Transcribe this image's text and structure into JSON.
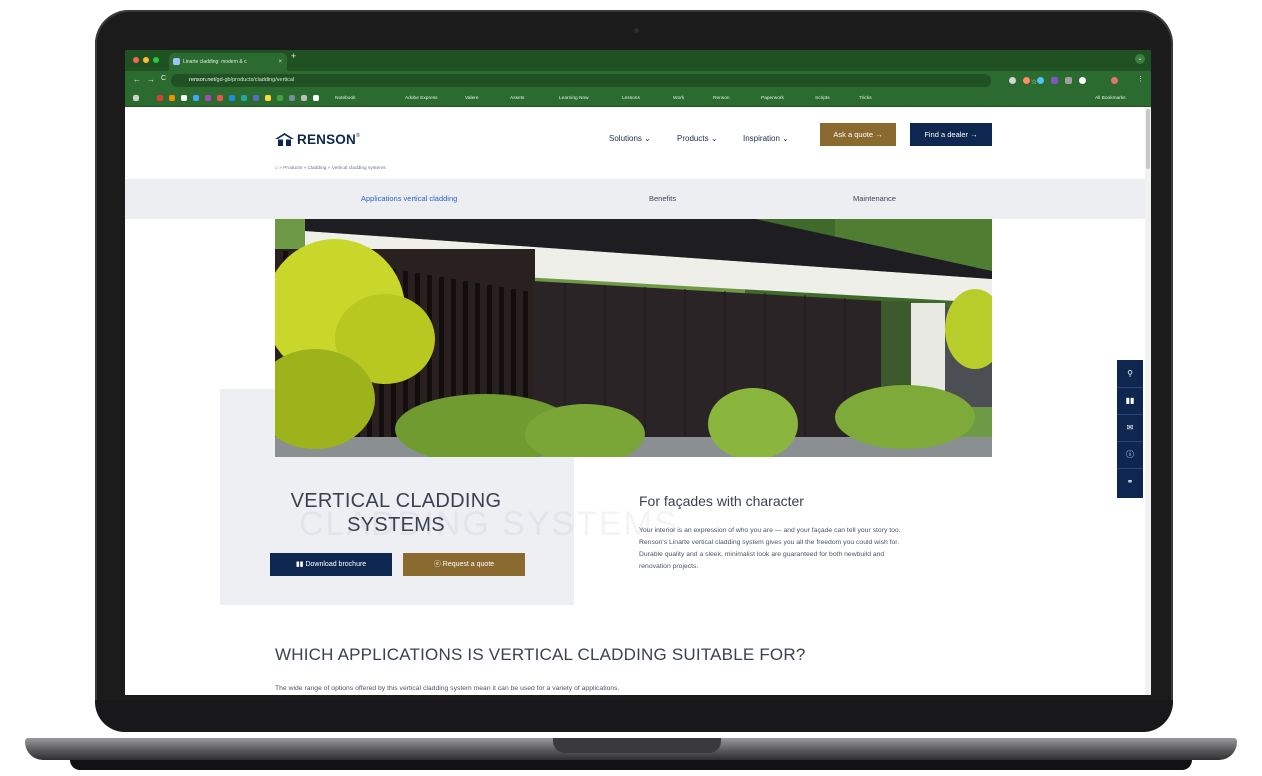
{
  "browser": {
    "tab_title": "Linarte cladding: modern & c",
    "tab_close": "×",
    "new_tab": "+",
    "menu": "⌄",
    "url_host": "renson.net",
    "url_path": "/gd-gb/products/cladding/vertical",
    "nav_back": "←",
    "nav_forward": "→",
    "nav_reload": "C",
    "bookmark_star": "☆",
    "bookmarks": [
      "Notebook",
      "Adobe Express",
      "Valere",
      "Assets",
      "Learning Now",
      "Lessons",
      "Work",
      "Renson",
      "Paperwork",
      "Scripts",
      "Tricks"
    ],
    "all_bookmarks": "All Bookmarks"
  },
  "header": {
    "logo_text": "RENSON",
    "logo_registered": "®",
    "nav": [
      "Solutions",
      "Products",
      "Inspiration"
    ],
    "nav_caret": "⌄",
    "ask_quote": "Ask a quote →",
    "find_dealer": "Find a dealer →"
  },
  "breadcrumb": "⌂ » Products » Cladding » Vertical cladding systems",
  "subnav": [
    "Applications vertical cladding",
    "Benefits",
    "Maintenance"
  ],
  "intro": {
    "title": "VERTICAL CLADDING SYSTEMS",
    "ghost": "CLADDING SYSTEMS",
    "download_label": "Download brochure",
    "request_label": "Request a quote",
    "heading": "For façades with character",
    "text": "Your interior is an expression of who you are — and your façade can tell your story too. Renson's Linarte vertical cladding system gives you all the freedom you could wish for. Durable quality and a sleek, minimalist look are guaranteed for both newbuild and renovation projects."
  },
  "section": {
    "heading": "WHICH APPLICATIONS IS VERTICAL CLADDING SUITABLE FOR?",
    "text": "The wide range of options offered by this vertical cladding system mean it can be used for a variety of applications."
  },
  "side_rail": [
    "map-pin-icon",
    "brochure-icon",
    "mail-icon",
    "info-icon",
    "share-icon"
  ],
  "colors": {
    "navy": "#0e2750",
    "gold": "#8a6a2e",
    "chrome_green": "#2b6b2f",
    "link_blue": "#2f60c8"
  }
}
